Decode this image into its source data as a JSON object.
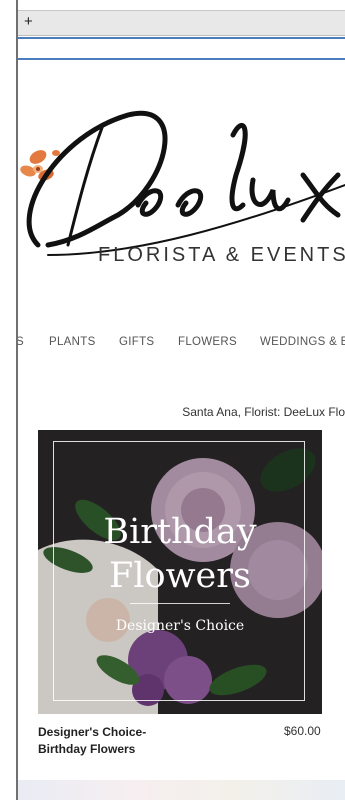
{
  "browser": {
    "new_tab_label": "+"
  },
  "brand": {
    "logo_text": "Deelux",
    "subtitle": "FLORISTA & EVENTS"
  },
  "nav": {
    "items": [
      "S",
      "PLANTS",
      "GIFTS",
      "FLOWERS",
      "WEDDINGS & E"
    ]
  },
  "breadcrumb": "Santa Ana, Florist: DeeLux Flo",
  "product": {
    "image_title_line1": "Birthday",
    "image_title_line2": "Flowers",
    "image_subtitle": "Designer's Choice",
    "name": "Designer's Choice- Birthday Flowers",
    "price": "$60.00"
  },
  "colors": {
    "accent_blue": "#4a7dbd",
    "logo_flower": "#e27a3f"
  }
}
